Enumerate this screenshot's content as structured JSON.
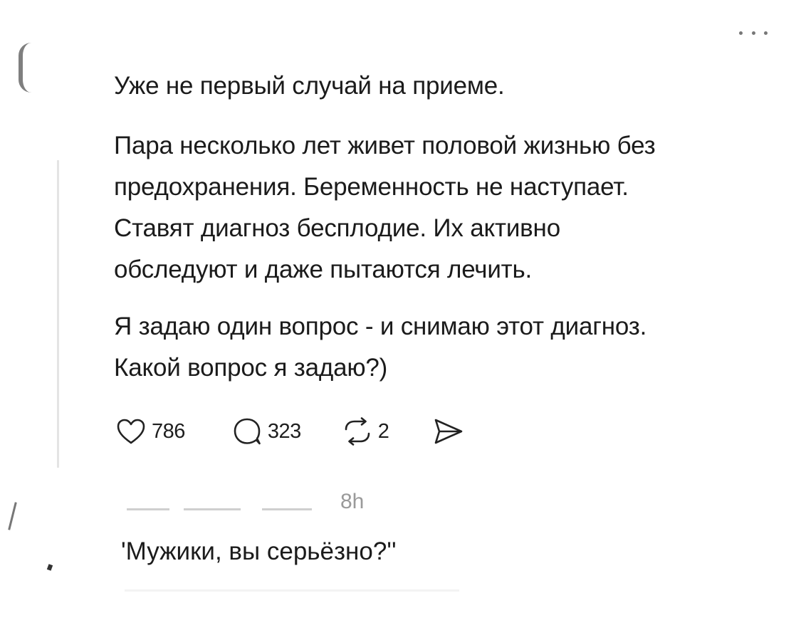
{
  "post": {
    "paragraphs": [
      [
        "Уже не первый случай на приеме."
      ],
      [
        "Пара несколько лет живет половой жизнью без",
        "предохранения. Беременность не наступает.",
        "Ставят диагноз бесплодие. Их активно",
        "обследуют и даже пытаются лечить."
      ],
      [
        "Я задаю один вопрос - и снимаю этот диагноз.",
        "Какой вопрос я задаю?)"
      ]
    ],
    "stats": {
      "likes": "786",
      "replies": "323",
      "reposts": "2"
    },
    "icons": {
      "more": "more-horizontal-icon",
      "like": "heart-icon",
      "reply": "comment-bubble-icon",
      "repost": "repost-arrows-icon",
      "share": "send-icon"
    }
  },
  "reply": {
    "time": "8h",
    "text": "'Мужики, вы серьёзно?''"
  },
  "colors": {
    "text": "#1b1b1b",
    "muted": "#9a9a9a",
    "icon": "#222222",
    "thread_line": "#e4e4e4"
  }
}
